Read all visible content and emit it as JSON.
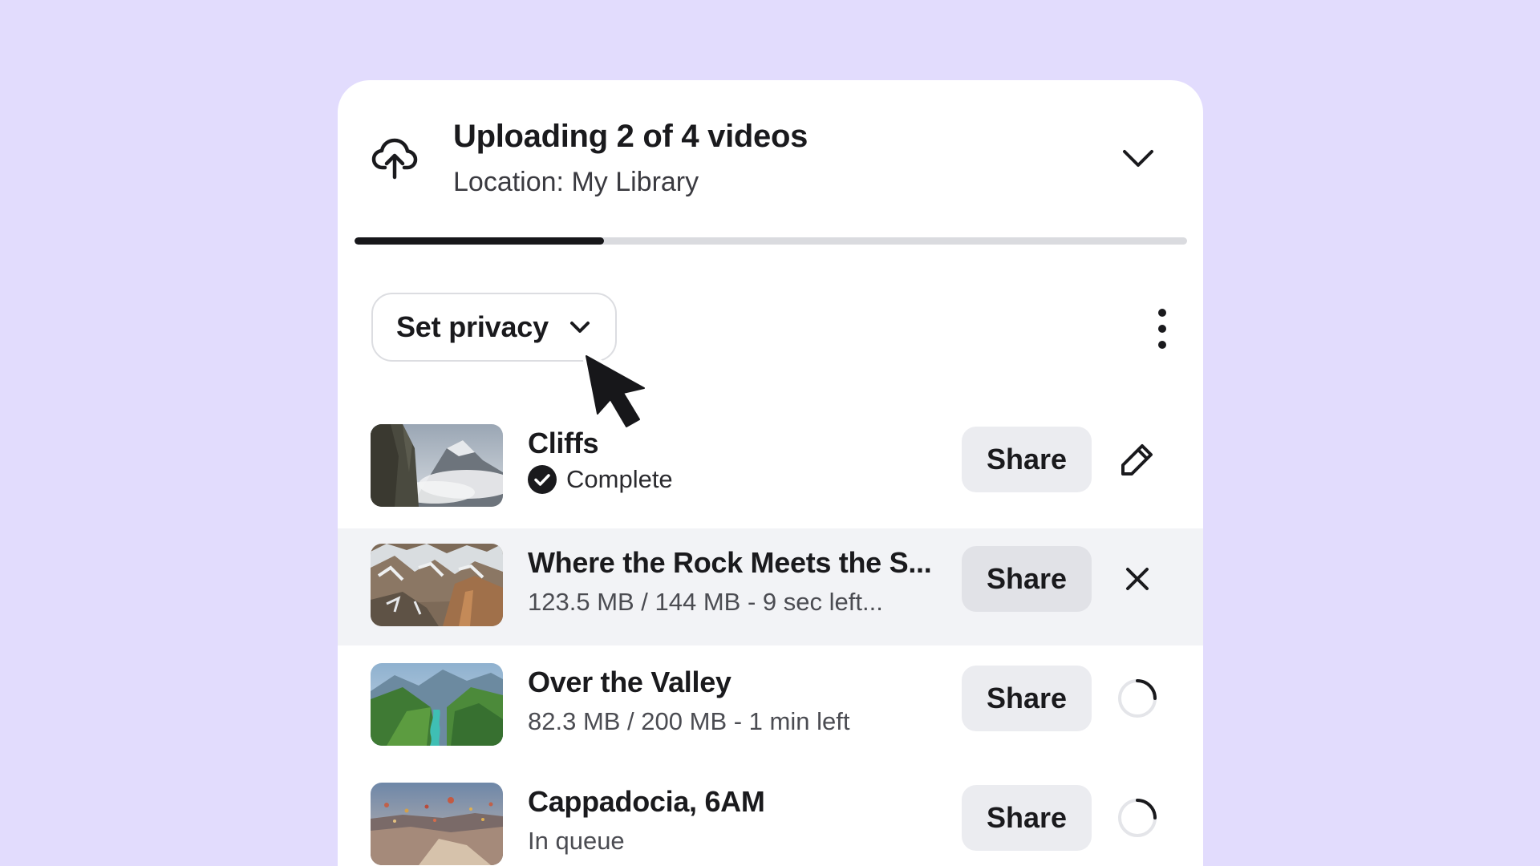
{
  "header": {
    "icon": "cloud-upload-icon",
    "title": "Uploading 2 of 4 videos",
    "location": "Location: My Library",
    "collapse_icon": "chevron-down-icon"
  },
  "progress": {
    "fraction": 0.3
  },
  "toolbar": {
    "privacy_label": "Set privacy",
    "privacy_icon": "chevron-down-icon",
    "more_icon": "more-vertical-icon"
  },
  "videos": [
    {
      "title": "Cliffs",
      "status": "Complete",
      "share_label": "Share",
      "action_icon": "pencil-icon"
    },
    {
      "title": "Where the Rock Meets the S...",
      "status": "123.5 MB / 144 MB - 9 sec left...",
      "share_label": "Share",
      "action_icon": "close-icon"
    },
    {
      "title": "Over the Valley",
      "status": "82.3 MB / 200 MB - 1 min left",
      "share_label": "Share",
      "action_icon": "spinner-icon"
    },
    {
      "title": "Cappadocia, 6AM",
      "status": "In queue",
      "share_label": "Share",
      "action_icon": "spinner-icon"
    }
  ],
  "colors": {
    "background": "#e2dcfd",
    "panel": "#ffffff",
    "progress_fill": "#17171a",
    "progress_track": "#dadbdf",
    "button_bg": "#ebecf0",
    "active_row": "#f2f3f6"
  }
}
